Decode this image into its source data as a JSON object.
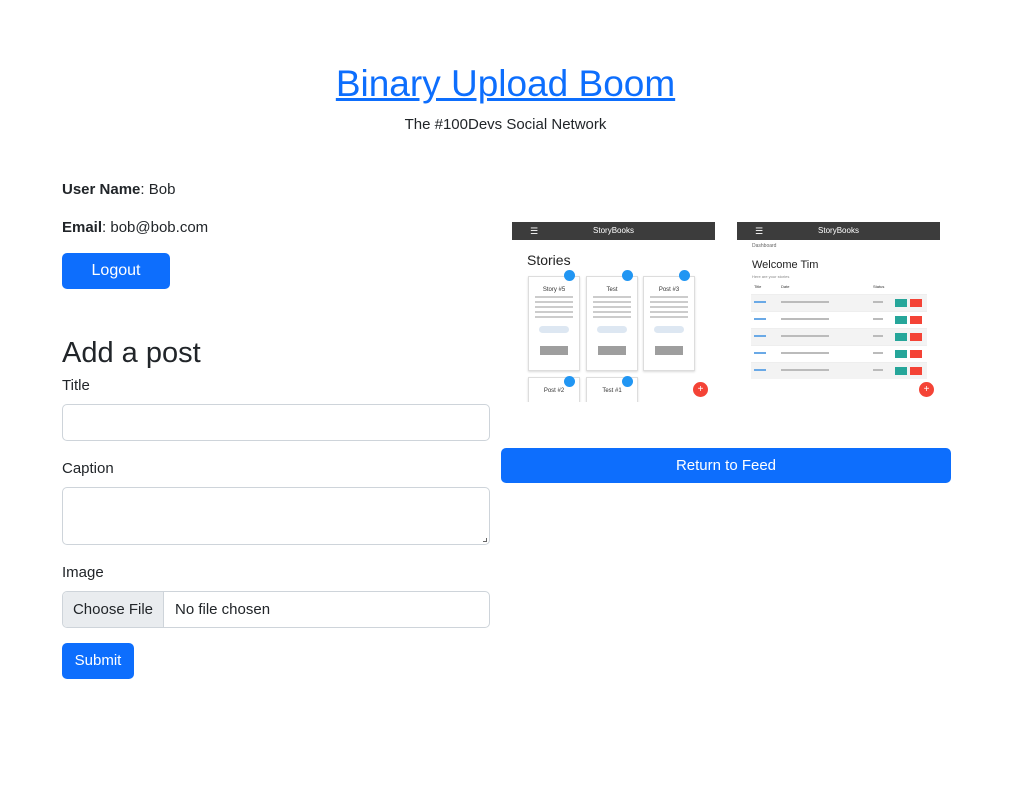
{
  "header": {
    "title": "Binary Upload Boom",
    "tagline": "The #100Devs Social Network"
  },
  "profile": {
    "username_label": "User Name",
    "username_value": ": Bob",
    "email_label": "Email",
    "email_value": ": bob@bob.com",
    "logout_label": "Logout"
  },
  "post_form": {
    "heading": "Add a post",
    "title_label": "Title",
    "caption_label": "Caption",
    "image_label": "Image",
    "file_button_label": "Choose File",
    "file_status": "No file chosen",
    "submit_label": "Submit"
  },
  "preview": {
    "stories_app_bar": "StoryBooks",
    "stories_heading": "Stories",
    "story_cards": [
      "Story #5",
      "Test",
      "Post #3",
      "Post #2",
      "Test #1"
    ],
    "dashboard_app_bar": "StoryBooks",
    "dashboard_crumb": "Dashboard",
    "dashboard_heading": "Welcome Tim",
    "dashboard_sub": "Here are your stories",
    "dashboard_columns": [
      "Title",
      "Date",
      "Status"
    ],
    "dashboard_row_count": 5
  },
  "return_label": "Return to Feed",
  "colors": {
    "primary": "#0d6efd",
    "fab_red": "#f44336",
    "badge_blue": "#2196f3",
    "edit_green": "#26a69a"
  }
}
